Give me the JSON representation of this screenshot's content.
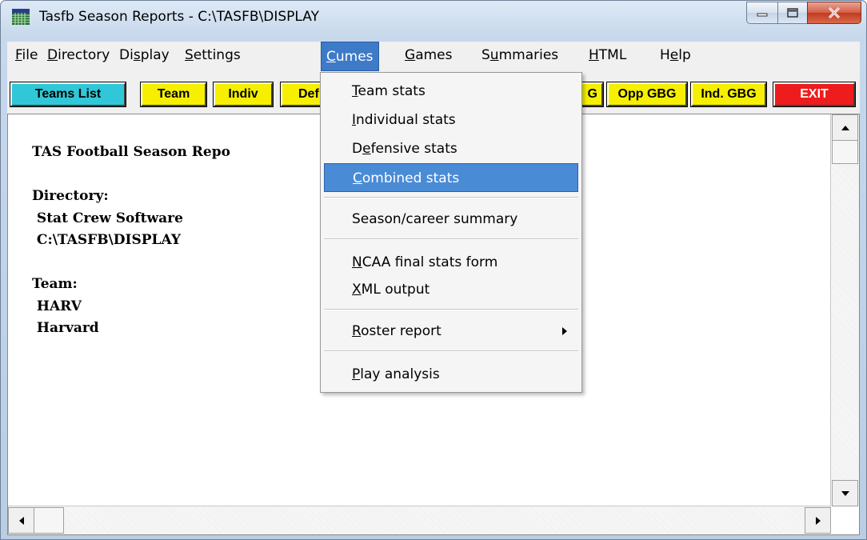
{
  "window": {
    "title": "Tasfb Season Reports - C:\\TASFB\\DISPLAY"
  },
  "menubar": [
    {
      "pre": "",
      "u": "F",
      "post": "ile"
    },
    {
      "pre": "",
      "u": "D",
      "post": "irectory"
    },
    {
      "pre": "Di",
      "u": "s",
      "post": "play"
    },
    {
      "pre": "",
      "u": "S",
      "post": "ettings"
    },
    {
      "pre": "",
      "u": "C",
      "post": "umes"
    },
    {
      "pre": "",
      "u": "G",
      "post": "ames"
    },
    {
      "pre": "S",
      "u": "u",
      "post": "mmaries"
    },
    {
      "pre": "",
      "u": "H",
      "post": "TML"
    },
    {
      "pre": "H",
      "u": "e",
      "post": "lp"
    }
  ],
  "toolbar": {
    "teams_list": "Teams List",
    "team": "Team",
    "indiv": "Indiv",
    "def": "Def",
    "g_partial": "G",
    "opp_gbg": "Opp GBG",
    "ind_gbg": "Ind. GBG",
    "exit": "EXIT"
  },
  "content": {
    "report_title": "TAS Football Season Repo",
    "directory_label": "Directory:",
    "directory_name": " Stat Crew Software",
    "directory_path": " C:\\TASFB\\DISPLAY",
    "team_label": "Team:",
    "team_code": " HARV",
    "team_name": " Harvard"
  },
  "cumes_menu": {
    "team_stats": {
      "pre": "",
      "u": "T",
      "post": "eam stats"
    },
    "individual_stats": {
      "pre": "",
      "u": "I",
      "post": "ndividual stats"
    },
    "defensive_stats": {
      "pre": "D",
      "u": "e",
      "post": "fensive stats"
    },
    "combined_stats": {
      "pre": "",
      "u": "C",
      "post": "ombined stats"
    },
    "season_career_summary": {
      "pre": "",
      "u": "",
      "post": "Season/career summary"
    },
    "ncaa_final_stats_form": {
      "pre": "",
      "u": "N",
      "post": "CAA final stats form"
    },
    "xml_output": {
      "pre": "",
      "u": "X",
      "post": "ML output"
    },
    "roster_report": {
      "pre": "",
      "u": "R",
      "post": "oster report"
    },
    "play_analysis": {
      "pre": "",
      "u": "P",
      "post": "lay analysis"
    }
  },
  "icons": {
    "app": "grid-app-icon",
    "minimize": "minimize-icon",
    "maximize": "maximize-icon",
    "close": "close-icon",
    "submenu": "submenu-arrow-icon"
  },
  "colors": {
    "teams_list_btn": "#30c8d8",
    "yellow_btn": "#f6f000",
    "exit_btn": "#ee1c1c",
    "menu_highlight": "#4a8bd6"
  }
}
